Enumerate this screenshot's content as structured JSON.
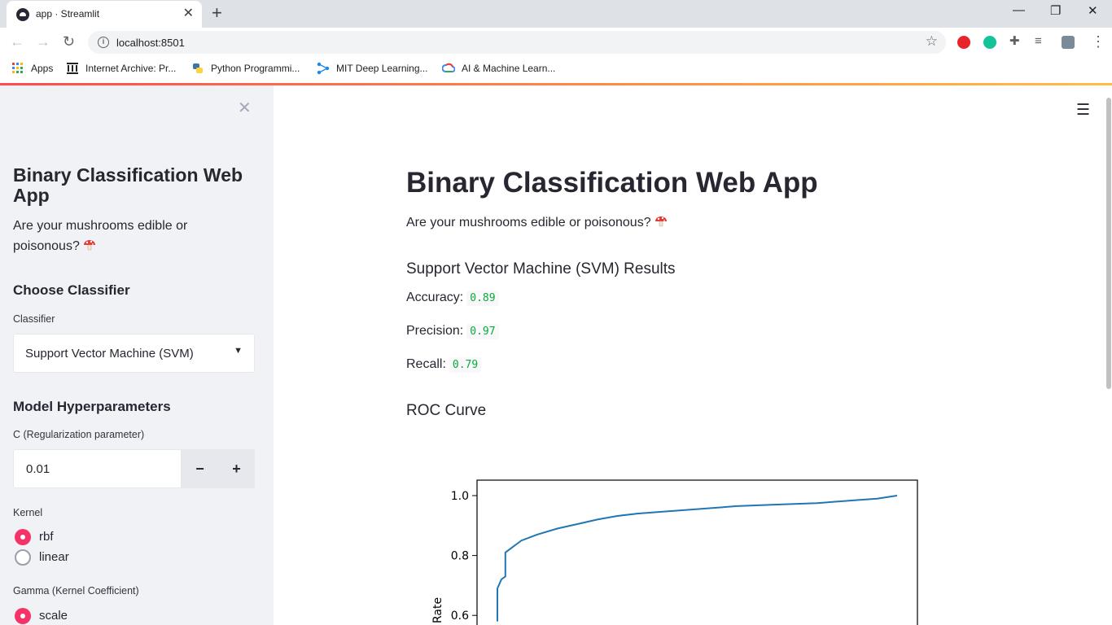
{
  "browser": {
    "tab_title": "app · Streamlit",
    "url": "localhost:8501",
    "bookmarks": [
      {
        "label": "Apps"
      },
      {
        "label": "Internet Archive: Pr..."
      },
      {
        "label": "Python Programmi..."
      },
      {
        "label": "MIT Deep Learning..."
      },
      {
        "label": "AI & Machine Learn..."
      }
    ]
  },
  "sidebar": {
    "title": "Binary Classification Web App",
    "subtitle": "Are your mushrooms edible or poisonous?",
    "choose_heading": "Choose Classifier",
    "classifier_label": "Classifier",
    "classifier_value": "Support Vector Machine (SVM)",
    "hyper_heading": "Model Hyperparameters",
    "c_label": "C (Regularization parameter)",
    "c_value": "0.01",
    "minus": "−",
    "plus": "+",
    "kernel_label": "Kernel",
    "kernel_options": [
      "rbf",
      "linear"
    ],
    "kernel_selected": "rbf",
    "gamma_label": "Gamma (Kernel Coefficient)",
    "gamma_options": [
      "scale"
    ],
    "gamma_selected": "scale"
  },
  "main": {
    "title": "Binary Classification Web App",
    "subtitle": "Are your mushrooms edible or poisonous?",
    "results_heading": "Support Vector Machine (SVM) Results",
    "metrics": [
      {
        "label": "Accuracy:",
        "value": "0.89"
      },
      {
        "label": "Precision:",
        "value": "0.97"
      },
      {
        "label": "Recall:",
        "value": "0.79"
      }
    ],
    "roc_heading": "ROC Curve"
  },
  "colors": {
    "accent": "#f63366",
    "code_green": "#09ab3b",
    "curve": "#1f77b4"
  },
  "chart_data": {
    "type": "line",
    "ylabel_visible_fragment": "Rate",
    "yticks": [
      0.6,
      0.8,
      1.0
    ],
    "series": [
      {
        "x": [
          0.0,
          0.0,
          0.01,
          0.02,
          0.02,
          0.04,
          0.06,
          0.1,
          0.15,
          0.2,
          0.25,
          0.3,
          0.35,
          0.4,
          0.5,
          0.6,
          0.7,
          0.8,
          0.9,
          0.95,
          1.0
        ],
        "y": [
          0.58,
          0.69,
          0.72,
          0.73,
          0.81,
          0.83,
          0.85,
          0.87,
          0.89,
          0.905,
          0.92,
          0.932,
          0.94,
          0.945,
          0.955,
          0.965,
          0.97,
          0.975,
          0.985,
          0.99,
          1.0
        ]
      }
    ]
  }
}
